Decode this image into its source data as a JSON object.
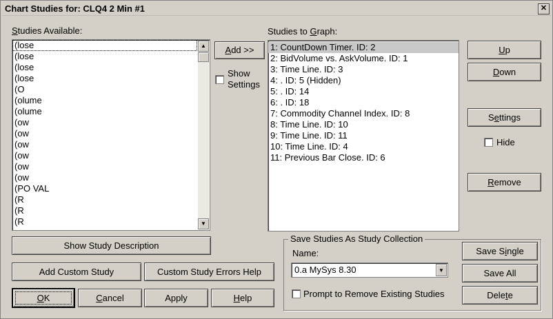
{
  "window": {
    "title": "Chart Studies for: CLQ4   2 Min   #1",
    "close_glyph": "✕"
  },
  "available": {
    "label_accel": "S",
    "label_rest": "tudies Available:",
    "items": [
      "(lose",
      "(lose",
      "(lose",
      "(lose",
      "(O",
      "(olume",
      "(olume",
      "(ow",
      "(ow",
      "(ow",
      "(ow",
      "(ow",
      "(ow",
      "(PO VAL",
      "(R",
      "(R",
      "(R"
    ]
  },
  "add_button": {
    "accel": "A",
    "rest": "dd >>"
  },
  "show_settings": {
    "line1": "Show",
    "line2": "Settings",
    "checked": false
  },
  "graph": {
    "label_pre": "Studies to ",
    "label_accel": "G",
    "label_rest": "raph:",
    "items": [
      "1: CountDown Timer. ID: 2",
      "2: BidVolume vs. AskVolume. ID: 1",
      "3: Time Line. ID: 3",
      "4: . ID: 5 (Hidden)",
      "5: . ID: 14",
      "6: . ID: 18",
      "7: Commodity Channel Index. ID: 8",
      "8: Time Line. ID: 10",
      "9: Time Line. ID: 11",
      "10: Time Line. ID: 4",
      "11: Previous Bar Close. ID: 6"
    ],
    "selected_index": 0
  },
  "right_buttons": {
    "up": {
      "accel": "U",
      "rest": "p"
    },
    "down": {
      "accel": "D",
      "rest": "own"
    },
    "settings": {
      "pre": "S",
      "accel": "e",
      "rest": "ttings"
    },
    "hide": {
      "label": "Hide",
      "checked": false
    },
    "remove": {
      "accel": "R",
      "rest": "emove"
    }
  },
  "buttons": {
    "show_description": "Show Study Description",
    "add_custom": "Add Custom Study",
    "custom_errors": "Custom Study Errors Help",
    "ok": {
      "accel": "O",
      "rest": "K"
    },
    "cancel": {
      "accel": "C",
      "rest": "ancel"
    },
    "apply": "Apply",
    "help": {
      "accel": "H",
      "rest": "elp"
    }
  },
  "collection": {
    "title": "Save Studies As Study Collection",
    "name_label": "Name:",
    "name_value": "0.a MySys 8.30",
    "prompt": "Prompt to Remove Existing Studies",
    "prompt_checked": false,
    "save_single": {
      "pre": "Save S",
      "accel": "i",
      "rest": "ngle"
    },
    "save_all": "Save All",
    "delete": {
      "pre": "Dele",
      "accel": "t",
      "rest": "e"
    }
  }
}
